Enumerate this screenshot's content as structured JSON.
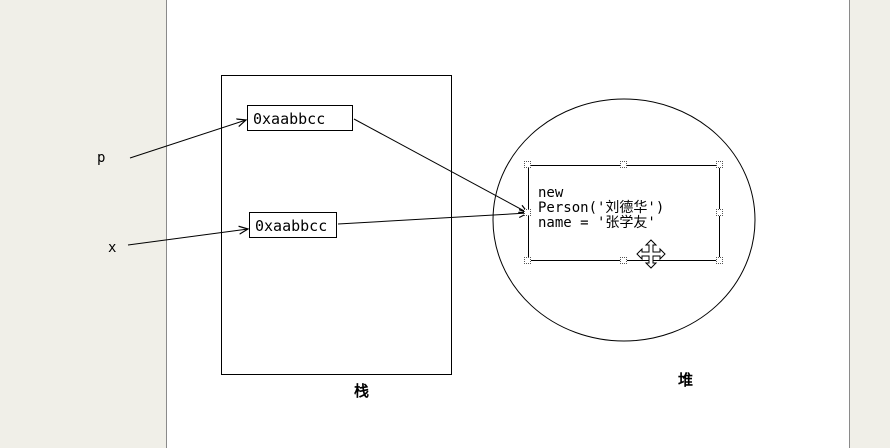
{
  "variables": {
    "p": "p",
    "x": "x"
  },
  "stack": {
    "caption": "栈",
    "refs": {
      "p": "0xaabbcc",
      "x": "0xaabbcc"
    }
  },
  "heap": {
    "caption": "堆",
    "object_lines": [
      "new",
      "Person('刘德华')",
      "name = '张学友'"
    ]
  },
  "colors": {
    "line": "#000000",
    "canvas": "#ffffff",
    "background": "#f0efe8"
  },
  "icons": {
    "cursor": "move-cursor-icon",
    "handles": "selection-handle-icon"
  }
}
